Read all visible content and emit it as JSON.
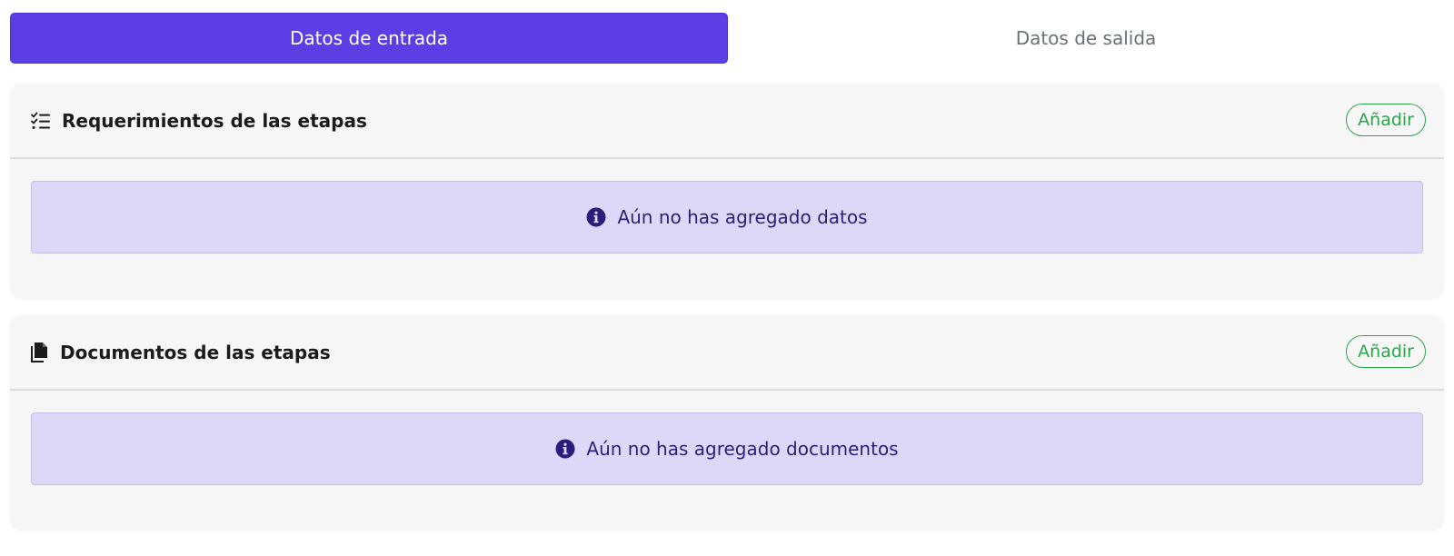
{
  "tabs": [
    {
      "label": "Datos de entrada",
      "active": true
    },
    {
      "label": "Datos de salida",
      "active": false
    }
  ],
  "sections": [
    {
      "title": "Requerimientos de las etapas",
      "icon": "checklist-icon",
      "add_label": "Añadir",
      "empty_message": "Aún no has agregado datos"
    },
    {
      "title": "Documentos de las etapas",
      "icon": "documents-icon",
      "add_label": "Añadir",
      "empty_message": "Aún no has agregado documentos"
    }
  ],
  "colors": {
    "accent": "#5b3ee4",
    "success": "#2aa54a",
    "alert_bg": "#ddd8f7",
    "alert_text": "#2d1d7a",
    "card_bg": "#f6f6f6"
  }
}
